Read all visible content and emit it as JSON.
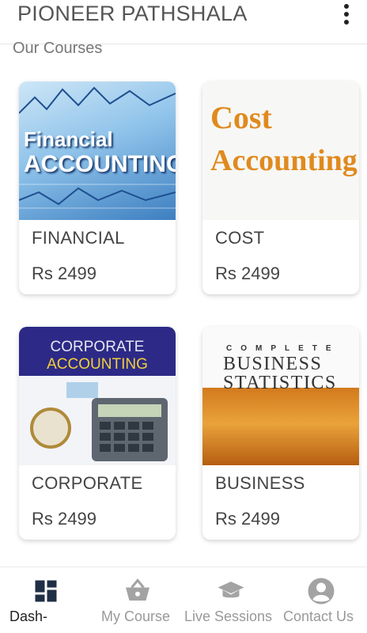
{
  "app": {
    "title": "PIONEER PATHSHALA"
  },
  "section": {
    "title": "Our Courses"
  },
  "courses": [
    {
      "name": "FINANCIAL",
      "price": "Rs 2499",
      "thumb_lines": [
        "Financial",
        "ACCOUNTING"
      ]
    },
    {
      "name": "COST",
      "price": "Rs 2499",
      "thumb_lines": [
        "Cost",
        "Accounting"
      ]
    },
    {
      "name": "CORPORATE",
      "price": "Rs 2499",
      "thumb_lines": [
        "CORPORATE",
        "ACCOUNTING"
      ]
    },
    {
      "name": "BUSINESS",
      "price": "Rs 2499",
      "thumb_lines": [
        "COMPLETE",
        "BUSINESS",
        "STATISTICS"
      ]
    }
  ],
  "nav": [
    {
      "label": "Dash-",
      "icon": "dashboard-icon",
      "active": true
    },
    {
      "label": "My Course",
      "icon": "basket-icon",
      "active": false
    },
    {
      "label": "Live Sessions",
      "icon": "graduation-cap-icon",
      "active": false
    },
    {
      "label": "Contact Us",
      "icon": "account-circle-icon",
      "active": false
    }
  ],
  "colors": {
    "nav_icon_active": "#1f2f45",
    "nav_icon_inactive": "#a3a3a3",
    "brand_text": "#555555"
  }
}
